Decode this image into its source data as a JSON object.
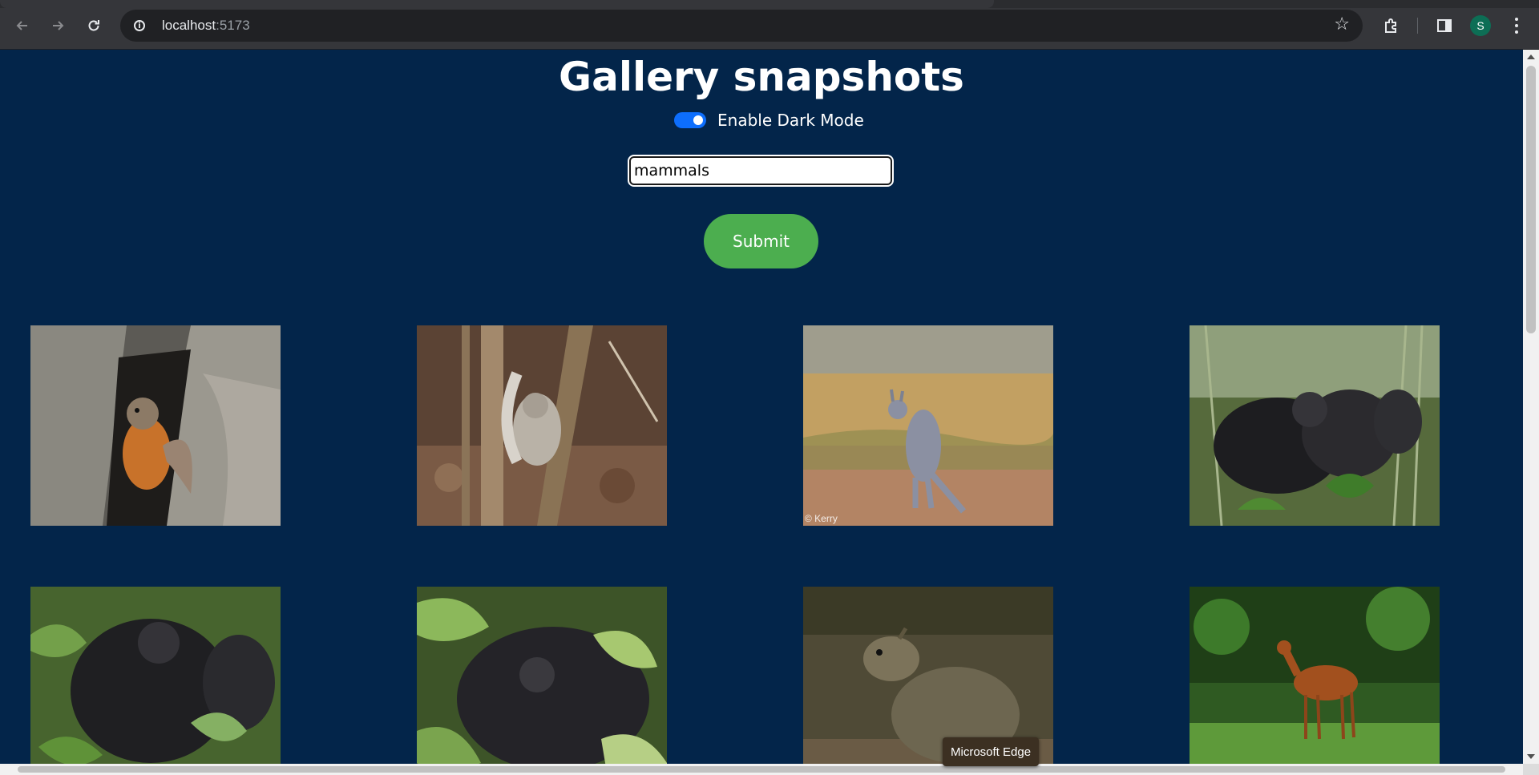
{
  "browser": {
    "url_host": "localhost",
    "url_port": ":5173",
    "profile_initial": "S",
    "icons": {
      "back": "back-arrow-icon",
      "forward": "forward-arrow-icon",
      "reload": "reload-icon",
      "site_info": "info-icon",
      "bookmark": "star-icon",
      "extensions": "puzzle-icon",
      "sidebar": "sidebar-icon",
      "menu": "kebab-menu-icon"
    }
  },
  "page": {
    "title": "Gallery snapshots",
    "dark_mode_label": "Enable Dark Mode",
    "dark_mode_enabled": true,
    "search_value": "mammals",
    "submit_label": "Submit",
    "images": [
      {
        "subject": "fox squirrel in tree hollow",
        "credit": ""
      },
      {
        "subject": "gray squirrel on branch",
        "credit": ""
      },
      {
        "subject": "kangaroo in grassland",
        "credit": "© Kerry"
      },
      {
        "subject": "gorillas in foliage",
        "credit": ""
      },
      {
        "subject": "gorilla family in leaves",
        "credit": ""
      },
      {
        "subject": "baby gorilla among leaves",
        "credit": ""
      },
      {
        "subject": "agouti sitting",
        "credit": ""
      },
      {
        "subject": "deer in green forest",
        "credit": ""
      }
    ]
  },
  "tooltip": {
    "text": "Microsoft Edge"
  },
  "colors": {
    "page_background": "#03254a",
    "submit_button": "#4cae4f",
    "toggle_on": "#0d6efd"
  }
}
